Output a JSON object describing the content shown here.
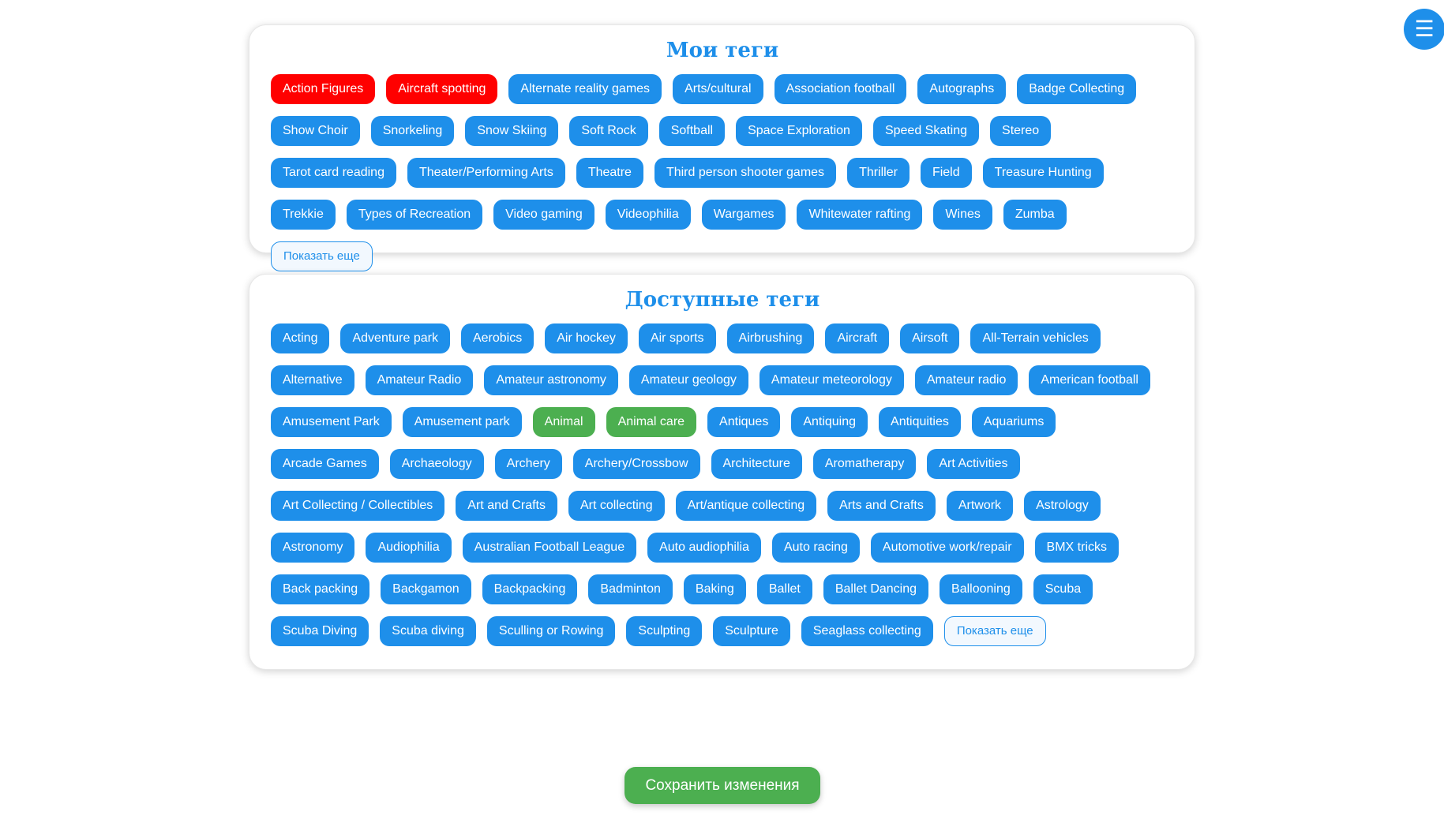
{
  "menu": {
    "icon": "hamburger-menu-icon",
    "glyph": "☰"
  },
  "my_tags": {
    "title": "Мои теги",
    "tags": [
      {
        "label": "Action Figures",
        "color": "red"
      },
      {
        "label": "Aircraft spotting",
        "color": "red"
      },
      {
        "label": "Alternate reality games",
        "color": "blue"
      },
      {
        "label": "Arts/cultural",
        "color": "blue"
      },
      {
        "label": "Association football",
        "color": "blue"
      },
      {
        "label": "Autographs",
        "color": "blue"
      },
      {
        "label": "Badge Collecting",
        "color": "blue"
      },
      {
        "label": "Show Choir",
        "color": "blue"
      },
      {
        "label": "Snorkeling",
        "color": "blue"
      },
      {
        "label": "Snow Skiing",
        "color": "blue"
      },
      {
        "label": "Soft Rock",
        "color": "blue"
      },
      {
        "label": "Softball",
        "color": "blue"
      },
      {
        "label": "Space Exploration",
        "color": "blue"
      },
      {
        "label": "Speed Skating",
        "color": "blue"
      },
      {
        "label": "Stereo",
        "color": "blue"
      },
      {
        "label": "Tarot card reading",
        "color": "blue"
      },
      {
        "label": "Theater/Performing Arts",
        "color": "blue"
      },
      {
        "label": "Theatre",
        "color": "blue"
      },
      {
        "label": "Third person shooter games",
        "color": "blue"
      },
      {
        "label": "Thriller",
        "color": "blue"
      },
      {
        "label": "Field",
        "color": "blue"
      },
      {
        "label": "Treasure Hunting",
        "color": "blue"
      },
      {
        "label": "Trekkie",
        "color": "blue"
      },
      {
        "label": "Types of Recreation",
        "color": "blue"
      },
      {
        "label": "Video gaming",
        "color": "blue"
      },
      {
        "label": "Videophilia",
        "color": "blue"
      },
      {
        "label": "Wargames",
        "color": "blue"
      },
      {
        "label": "Whitewater rafting",
        "color": "blue"
      },
      {
        "label": "Wines",
        "color": "blue"
      },
      {
        "label": "Zumba",
        "color": "blue"
      }
    ],
    "show_more": "Показать еще"
  },
  "available_tags": {
    "title": "Доступные теги",
    "tags": [
      {
        "label": "Acting",
        "color": "blue"
      },
      {
        "label": "Adventure park",
        "color": "blue"
      },
      {
        "label": "Aerobics",
        "color": "blue"
      },
      {
        "label": "Air hockey",
        "color": "blue"
      },
      {
        "label": "Air sports",
        "color": "blue"
      },
      {
        "label": "Airbrushing",
        "color": "blue"
      },
      {
        "label": "Aircraft",
        "color": "blue"
      },
      {
        "label": "Airsoft",
        "color": "blue"
      },
      {
        "label": "All-Terrain vehicles",
        "color": "blue"
      },
      {
        "label": "Alternative",
        "color": "blue"
      },
      {
        "label": "Amateur Radio",
        "color": "blue"
      },
      {
        "label": "Amateur astronomy",
        "color": "blue"
      },
      {
        "label": "Amateur geology",
        "color": "blue"
      },
      {
        "label": "Amateur meteorology",
        "color": "blue"
      },
      {
        "label": "Amateur radio",
        "color": "blue"
      },
      {
        "label": "American football",
        "color": "blue"
      },
      {
        "label": "Amusement Park",
        "color": "blue"
      },
      {
        "label": "Amusement park",
        "color": "blue"
      },
      {
        "label": "Animal",
        "color": "green"
      },
      {
        "label": "Animal care",
        "color": "green"
      },
      {
        "label": "Antiques",
        "color": "blue"
      },
      {
        "label": "Antiquing",
        "color": "blue"
      },
      {
        "label": "Antiquities",
        "color": "blue"
      },
      {
        "label": "Aquariums",
        "color": "blue"
      },
      {
        "label": "Arcade Games",
        "color": "blue"
      },
      {
        "label": "Archaeology",
        "color": "blue"
      },
      {
        "label": "Archery",
        "color": "blue"
      },
      {
        "label": "Archery/Crossbow",
        "color": "blue"
      },
      {
        "label": "Architecture",
        "color": "blue"
      },
      {
        "label": "Aromatherapy",
        "color": "blue"
      },
      {
        "label": "Art Activities",
        "color": "blue"
      },
      {
        "label": "Art Collecting / Collectibles",
        "color": "blue"
      },
      {
        "label": "Art and Crafts",
        "color": "blue"
      },
      {
        "label": "Art collecting",
        "color": "blue"
      },
      {
        "label": "Art/antique collecting",
        "color": "blue"
      },
      {
        "label": "Arts and Crafts",
        "color": "blue"
      },
      {
        "label": "Artwork",
        "color": "blue"
      },
      {
        "label": "Astrology",
        "color": "blue"
      },
      {
        "label": "Astronomy",
        "color": "blue"
      },
      {
        "label": "Audiophilia",
        "color": "blue"
      },
      {
        "label": "Australian Football League",
        "color": "blue"
      },
      {
        "label": "Auto audiophilia",
        "color": "blue"
      },
      {
        "label": "Auto racing",
        "color": "blue"
      },
      {
        "label": "Automotive work/repair",
        "color": "blue"
      },
      {
        "label": "BMX tricks",
        "color": "blue"
      },
      {
        "label": "Back packing",
        "color": "blue"
      },
      {
        "label": "Backgamon",
        "color": "blue"
      },
      {
        "label": "Backpacking",
        "color": "blue"
      },
      {
        "label": "Badminton",
        "color": "blue"
      },
      {
        "label": "Baking",
        "color": "blue"
      },
      {
        "label": "Ballet",
        "color": "blue"
      },
      {
        "label": "Ballet Dancing",
        "color": "blue"
      },
      {
        "label": "Ballooning",
        "color": "blue"
      },
      {
        "label": "Scuba",
        "color": "blue"
      },
      {
        "label": "Scuba Diving",
        "color": "blue"
      },
      {
        "label": "Scuba diving",
        "color": "blue"
      },
      {
        "label": "Sculling or Rowing",
        "color": "blue"
      },
      {
        "label": "Sculpting",
        "color": "blue"
      },
      {
        "label": "Sculpture",
        "color": "blue"
      },
      {
        "label": "Seaglass collecting",
        "color": "blue"
      }
    ],
    "show_more": "Показать еще"
  },
  "save_button": "Сохранить изменения",
  "colors": {
    "accent": "#1e8fea",
    "selected_red": "#ff0000",
    "selected_green": "#4caf50",
    "save": "#4caf50"
  }
}
